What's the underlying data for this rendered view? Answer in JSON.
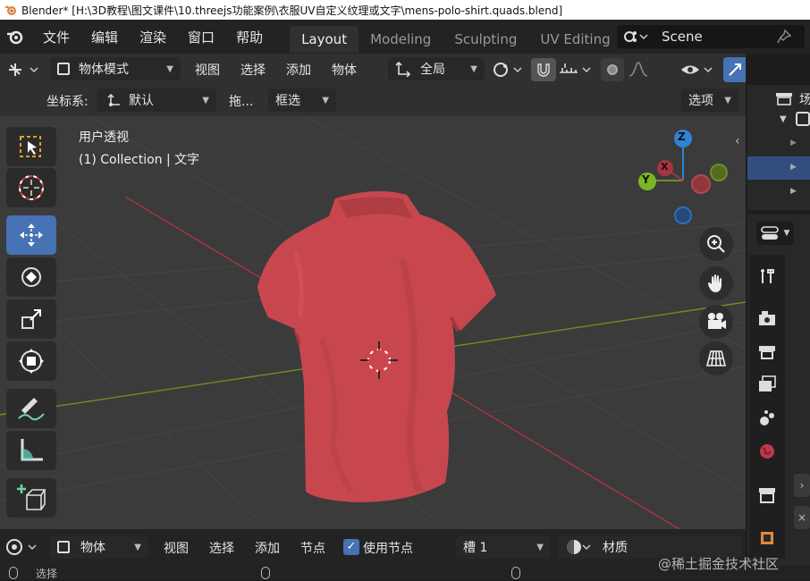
{
  "window": {
    "title": "Blender* [H:\\3D教程\\图文课件\\10.threejs功能案例\\衣服UV自定义纹理或文字\\mens-polo-shirt.quads.blend]"
  },
  "menu": {
    "items": [
      "文件",
      "编辑",
      "渲染",
      "窗口",
      "帮助"
    ]
  },
  "workspaces": [
    "Layout",
    "Modeling",
    "Sculpting",
    "UV Editing"
  ],
  "scene": {
    "name": "Scene"
  },
  "header": {
    "mode": "物体模式",
    "view": "视图",
    "select": "选择",
    "add": "添加",
    "object": "物体",
    "transform": "全局"
  },
  "subheader": {
    "coord_label": "坐标系:",
    "coord_value": "默认",
    "drag_label": "拖...",
    "drag_value": "框选",
    "options": "选项"
  },
  "viewport": {
    "view_name": "用户透视",
    "collection_info": "(1) Collection | 文字"
  },
  "gizmo": {
    "z": "Z",
    "y": "Y",
    "x": "X"
  },
  "bottom": {
    "editor": "物体",
    "view": "视图",
    "select": "选择",
    "add": "添加",
    "node": "节点",
    "use_nodes": "使用节点",
    "slot": "槽 1",
    "material": "材质"
  },
  "status": {
    "select": "选择"
  },
  "outliner": {
    "scene_char": "场"
  },
  "watermark": "@稀土掘金技术社区",
  "colors": {
    "accent": "#4772b3",
    "shirt": "#c8474f",
    "x_axis": "#a8353f",
    "y_axis": "#6b8f23",
    "z_axis": "#2f83d8"
  }
}
